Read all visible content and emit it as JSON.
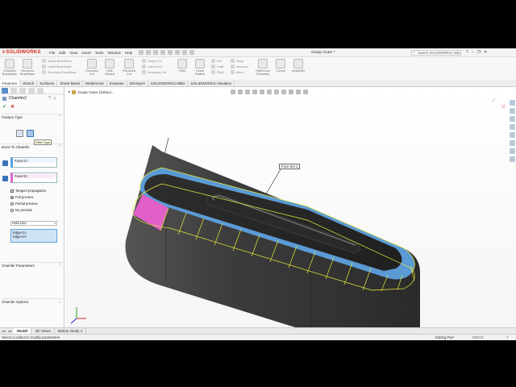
{
  "app": {
    "brand": "SOLIDWORKS",
    "document_title": "Grasp Outer *",
    "menus": [
      "File",
      "Edit",
      "View",
      "Insert",
      "Tools",
      "Window",
      "Help"
    ],
    "search_placeholder": "Search SOLIDWORKS Help"
  },
  "ribbon": {
    "big": [
      {
        "label": "Extruded Boss/Base",
        "icon": "extruded-boss-icon"
      },
      {
        "label": "Revolved Boss/Base",
        "icon": "revolved-boss-icon"
      },
      {
        "label": "Extruded Cut",
        "icon": "extruded-cut-icon"
      },
      {
        "label": "Hole Wizard",
        "icon": "hole-wizard-icon"
      },
      {
        "label": "Revolved Cut",
        "icon": "revolved-cut-icon"
      },
      {
        "label": "Fillet",
        "icon": "fillet-icon"
      },
      {
        "label": "Linear Pattern",
        "icon": "linear-pattern-icon"
      },
      {
        "label": "Reference Geometry",
        "icon": "reference-geometry-icon"
      },
      {
        "label": "Curves",
        "icon": "curves-icon"
      },
      {
        "label": "Instant3D",
        "icon": "instant3d-icon"
      }
    ],
    "small_boss": [
      "Swept Boss/Base",
      "Lofted Boss/Base",
      "Boundary Boss/Base"
    ],
    "small_cut": [
      "Swept Cut",
      "Lofted Cut",
      "Boundary Cut"
    ],
    "small_misc": [
      "Rib",
      "Draft",
      "Shell"
    ],
    "small_misc2": [
      "Wrap",
      "Intersect",
      "Mirror"
    ],
    "tabs": [
      "Features",
      "Sketch",
      "Surfaces",
      "Sheet Metal",
      "Weldments",
      "Evaluate",
      "DimXpert",
      "SOLIDWORKS MBD",
      "SOLIDWORKS Visualize"
    ]
  },
  "property_manager": {
    "title": "Chamfer2",
    "ok_symbol": "✓",
    "cancel_symbol": "✕",
    "feature_type_label": "Feature Type",
    "tooltip": "Fillet Type",
    "items_label": "Items To Chamfer",
    "face_set1": "Face<1>",
    "face_set2": "Face<2>",
    "tangent_propagation": "Tangent propagation",
    "full_preview": "Full preview",
    "partial_preview": "Partial preview",
    "no_preview": "No preview",
    "chamfer_params_label": "Chamfer Parameters",
    "param_method": "Hold Line",
    "edge1": "Edge<1>",
    "edge2": "Edge<2>",
    "chamfer_options_label": "Chamfer Options"
  },
  "graphics": {
    "tree_flyout": "Grasp Outer (Defaul...",
    "callout": "Face Set 1"
  },
  "bottom_tabs": [
    "Model",
    "3D Views",
    "Motion Study 1"
  ],
  "status": {
    "message": "Select a callout to modify parameters",
    "mode": "Editing Part",
    "units": "MMGS"
  },
  "colors": {
    "face_set1": "#5b9bd5",
    "face_set2": "#e060c8",
    "preview_lines": "#e8e83a",
    "body": "#3a3a3a"
  }
}
